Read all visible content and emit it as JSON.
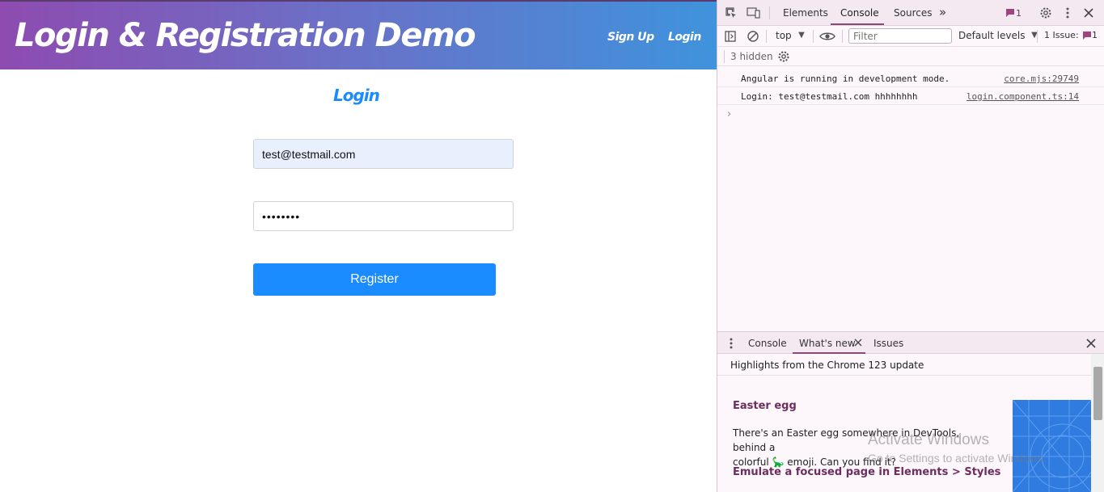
{
  "app": {
    "title": "Login & Registration Demo",
    "nav": {
      "signup": "Sign Up",
      "login": "Login"
    },
    "form": {
      "heading": "Login",
      "email_value": "test@testmail.com",
      "password_value": "••••••••",
      "submit_label": "Register"
    }
  },
  "devtools": {
    "tabs": [
      "Elements",
      "Console",
      "Sources"
    ],
    "active_tab": "Console",
    "more_tabs": "»",
    "issues_badge": "1",
    "toolbar": {
      "context": "top",
      "filter_placeholder": "Filter",
      "levels": "Default levels",
      "issues_label": "1 Issue:",
      "issues_count": "1",
      "hidden": "3 hidden"
    },
    "console_lines": [
      {
        "message": "Angular is running in development mode.",
        "source": "core.mjs:29749"
      },
      {
        "message": "Login: test@testmail.com hhhhhhhh",
        "source": "login.component.ts:14"
      }
    ],
    "prompt": "›",
    "drawer": {
      "tabs": [
        "Console",
        "What's new",
        "Issues"
      ],
      "active_tab": "What's new",
      "highlights": "Highlights from the Chrome 123 update",
      "section1_title": "Easter egg",
      "section1_body_1": "There's an Easter egg somewhere in DevTools, behind a",
      "section1_body_2": "colorful 🦕 emoji. Can you find it?",
      "section2_title": "Emulate a focused page in Elements > Styles"
    }
  },
  "overlay": {
    "watermark_title": "Activate Windows",
    "watermark_sub": "Go to Settings to activate Windows."
  },
  "colors": {
    "accent": "#1a8cff",
    "devtools_accent": "#8a4a78",
    "header_start": "#8e4bb0",
    "header_end": "#3f93dc"
  }
}
